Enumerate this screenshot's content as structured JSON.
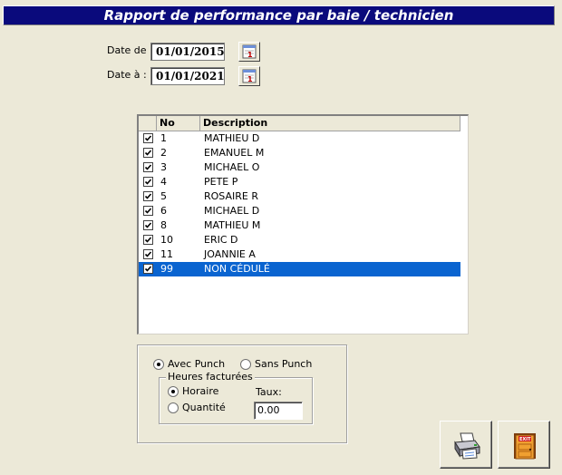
{
  "title": "Rapport de performance par baie / technicien",
  "date_from": {
    "label": "Date de :",
    "value": "01/01/2015"
  },
  "date_to": {
    "label": "Date à :",
    "value": "01/01/2021"
  },
  "list": {
    "headers": [
      "No",
      "Description"
    ],
    "rows": [
      {
        "no": "1",
        "desc": "MATHIEU D"
      },
      {
        "no": "2",
        "desc": "EMANUEL M"
      },
      {
        "no": "3",
        "desc": "MICHAEL O"
      },
      {
        "no": "4",
        "desc": "PETE P"
      },
      {
        "no": "5",
        "desc": "ROSAIRE R"
      },
      {
        "no": "6",
        "desc": "MICHAEL D"
      },
      {
        "no": "8",
        "desc": "MATHIEU M"
      },
      {
        "no": "10",
        "desc": "ERIC D"
      },
      {
        "no": "11",
        "desc": "JOANNIE A"
      },
      {
        "no": "99",
        "desc": "NON CÉDULÉ"
      }
    ],
    "selected_index": 9
  },
  "punch": {
    "avec": "Avec Punch",
    "sans": "Sans Punch",
    "selected": "avec"
  },
  "heures": {
    "legend": "Heures facturées",
    "horaire": "Horaire",
    "quantite": "Quantité",
    "selected": "horaire",
    "taux_label": "Taux:",
    "taux_value": "0.00"
  },
  "colors": {
    "title_bar": "#0a0a7c",
    "selection": "#0a64d0",
    "background": "#ece9d8"
  },
  "icons": {
    "calendar": "calendar-icon",
    "print": "printer-icon",
    "exit": "exit-door-icon"
  }
}
